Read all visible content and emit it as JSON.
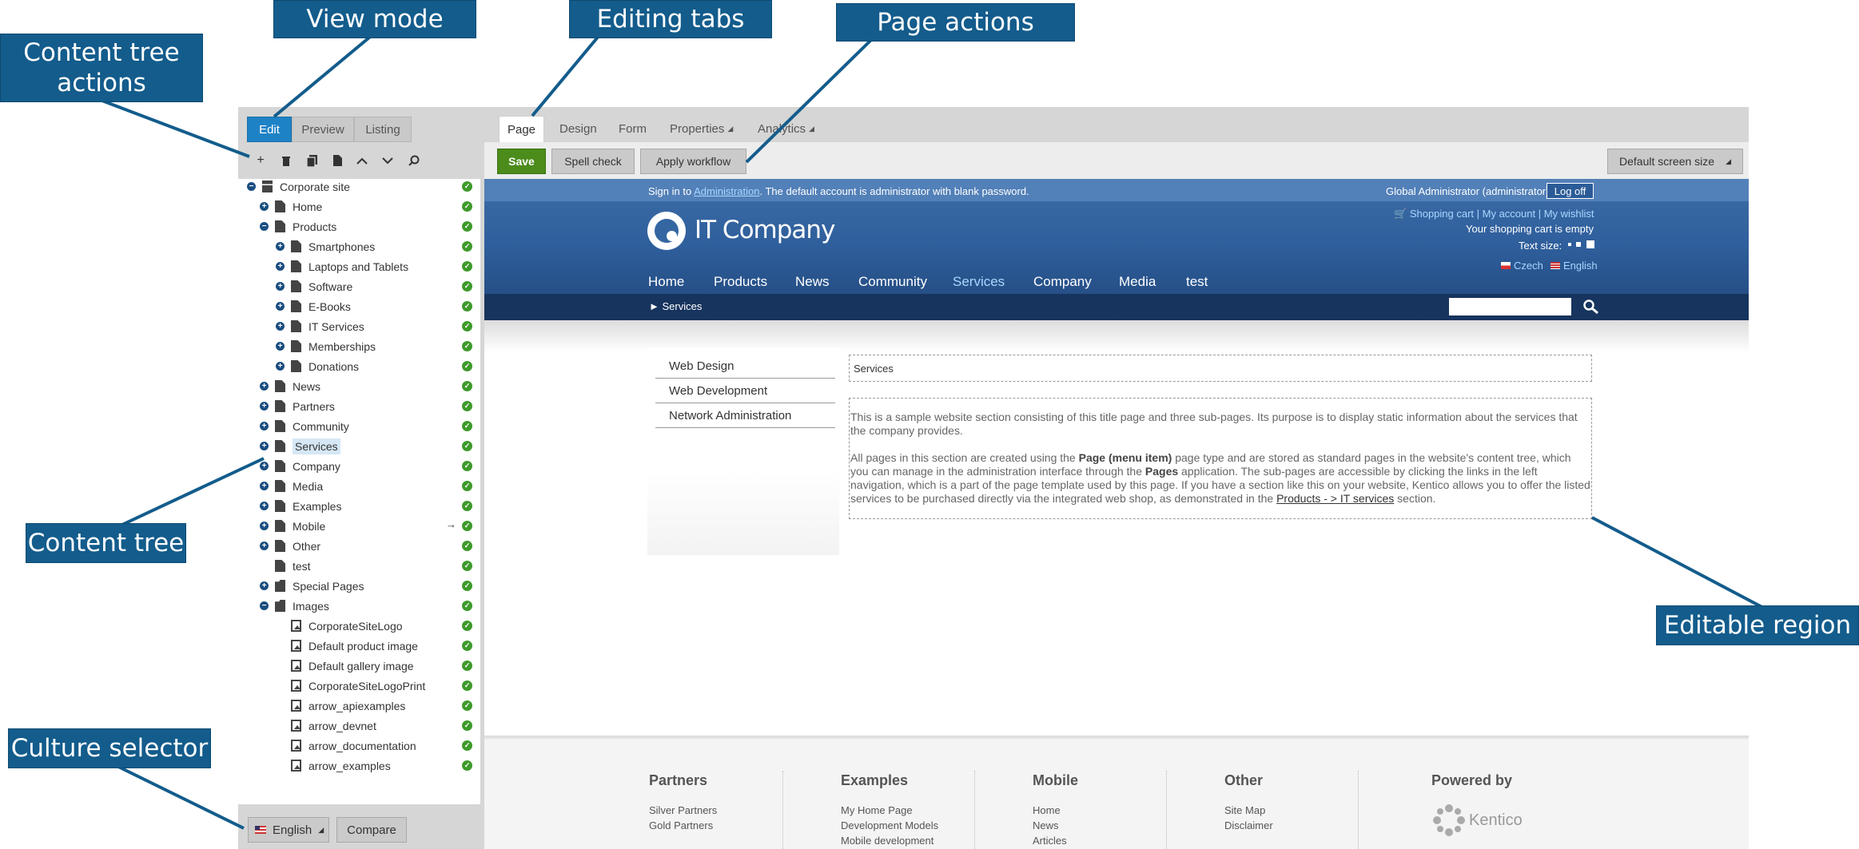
{
  "callouts": {
    "content_tree_actions": "Content tree actions",
    "view_mode": "View mode",
    "editing_tabs": "Editing tabs",
    "page_actions": "Page actions",
    "content_tree": "Content tree",
    "editable_region": "Editable region",
    "culture_selector": "Culture selector"
  },
  "view_modes": [
    "Edit",
    "Preview",
    "Listing"
  ],
  "tree_tools": [
    "add-icon",
    "delete-icon",
    "copy-icon",
    "move-icon",
    "up-icon",
    "down-icon",
    "search-icon"
  ],
  "tree": [
    {
      "label": "Corporate site",
      "toggle": "minus",
      "icon": "site",
      "level": 0
    },
    {
      "label": "Home",
      "toggle": "plus",
      "icon": "page",
      "level": 1
    },
    {
      "label": "Products",
      "toggle": "minus",
      "icon": "page",
      "level": 1
    },
    {
      "label": "Smartphones",
      "toggle": "plus",
      "icon": "page",
      "level": 2
    },
    {
      "label": "Laptops and Tablets",
      "toggle": "plus",
      "icon": "page",
      "level": 2
    },
    {
      "label": "Software",
      "toggle": "plus",
      "icon": "page",
      "level": 2
    },
    {
      "label": "E-Books",
      "toggle": "plus",
      "icon": "page",
      "level": 2
    },
    {
      "label": "IT Services",
      "toggle": "plus",
      "icon": "page",
      "level": 2
    },
    {
      "label": "Memberships",
      "toggle": "plus",
      "icon": "page",
      "level": 2
    },
    {
      "label": "Donations",
      "toggle": "plus",
      "icon": "page",
      "level": 2
    },
    {
      "label": "News",
      "toggle": "plus",
      "icon": "page",
      "level": 1
    },
    {
      "label": "Partners",
      "toggle": "plus",
      "icon": "page",
      "level": 1
    },
    {
      "label": "Community",
      "toggle": "plus",
      "icon": "page",
      "level": 1
    },
    {
      "label": "Services",
      "toggle": "plus",
      "icon": "page",
      "level": 1,
      "selected": true
    },
    {
      "label": "Company",
      "toggle": "plus",
      "icon": "page",
      "level": 1
    },
    {
      "label": "Media",
      "toggle": "plus",
      "icon": "page",
      "level": 1
    },
    {
      "label": "Examples",
      "toggle": "plus",
      "icon": "page",
      "level": 1
    },
    {
      "label": "Mobile",
      "toggle": "plus",
      "icon": "page",
      "level": 1,
      "arrow": "→"
    },
    {
      "label": "Other",
      "toggle": "plus",
      "icon": "page",
      "level": 1
    },
    {
      "label": "test",
      "toggle": "none",
      "icon": "page",
      "level": 1
    },
    {
      "label": "Special Pages",
      "toggle": "plus",
      "icon": "folder",
      "level": 1
    },
    {
      "label": "Images",
      "toggle": "minus",
      "icon": "folder",
      "level": 1
    },
    {
      "label": "CorporateSiteLogo",
      "toggle": "none",
      "icon": "img",
      "level": 2
    },
    {
      "label": "Default product image",
      "toggle": "none",
      "icon": "img",
      "level": 2
    },
    {
      "label": "Default gallery image",
      "toggle": "none",
      "icon": "img",
      "level": 2
    },
    {
      "label": "CorporateSiteLogoPrint",
      "toggle": "none",
      "icon": "img",
      "level": 2
    },
    {
      "label": "arrow_apiexamples",
      "toggle": "none",
      "icon": "img",
      "level": 2
    },
    {
      "label": "arrow_devnet",
      "toggle": "none",
      "icon": "img",
      "level": 2
    },
    {
      "label": "arrow_documentation",
      "toggle": "none",
      "icon": "img",
      "level": 2
    },
    {
      "label": "arrow_examples",
      "toggle": "none",
      "icon": "img",
      "level": 2
    }
  ],
  "culture": {
    "language": "English",
    "compare": "Compare"
  },
  "editing_tabs": [
    "Page",
    "Design",
    "Form",
    "Properties",
    "Analytics"
  ],
  "page_actions": {
    "save": "Save",
    "spell_check": "Spell check",
    "apply_workflow": "Apply workflow",
    "screen_size": "Default screen size"
  },
  "site": {
    "signin_pre": "Sign in to ",
    "signin_link": "Administration",
    "signin_post": ". The default account is administrator with blank password.",
    "user": "Global Administrator (administrator)",
    "logoff": "Log off",
    "logo": "IT Company",
    "cart_links": "Shopping cart | My account | My wishlist",
    "cart_status": "Your shopping cart is empty",
    "text_size": "Text size:",
    "lang_czech": "Czech",
    "lang_english": "English",
    "nav": [
      "Home",
      "Products",
      "News",
      "Community",
      "Services",
      "Company",
      "Media",
      "test"
    ],
    "breadcrumb": "► Services",
    "side_nav": [
      "Web Design",
      "Web Development",
      "Network Administration"
    ],
    "region_title": "Services",
    "para1": "This is a sample website section consisting of this title page and three sub-pages. Its purpose is to display static information about the services that the company provides.",
    "para2_a": "All pages in this section are created using the ",
    "para2_b": "Page (menu item)",
    "para2_c": " page type and are stored as standard pages in the website's content tree, which you can manage in the administration interface through the ",
    "para2_d": "Pages",
    "para2_e": " application. The sub-pages are accessible by clicking the links in the left navigation, which is a part of the page template used by this page. If you have a section like this on your website, Kentico allows you to offer the listed services to be purchased directly via the integrated web shop, as demonstrated in the ",
    "para2_link": "Products - > IT services",
    "para2_f": " section.",
    "footer": [
      {
        "title": "Partners",
        "links": [
          "Silver Partners",
          "Gold Partners"
        ]
      },
      {
        "title": "Examples",
        "links": [
          "My Home Page",
          "Development Models",
          "Mobile development"
        ]
      },
      {
        "title": "Mobile",
        "links": [
          "Home",
          "News",
          "Articles"
        ]
      },
      {
        "title": "Other",
        "links": [
          "Site Map",
          "Disclaimer"
        ]
      }
    ],
    "powered_by": "Powered by",
    "kentico": "Kentico"
  },
  "colors": {
    "callout": "#135c8c",
    "active": "#1e82c6",
    "save": "#4b8c1b",
    "check": "#3e9a2b",
    "header": "#2e5e9b"
  }
}
